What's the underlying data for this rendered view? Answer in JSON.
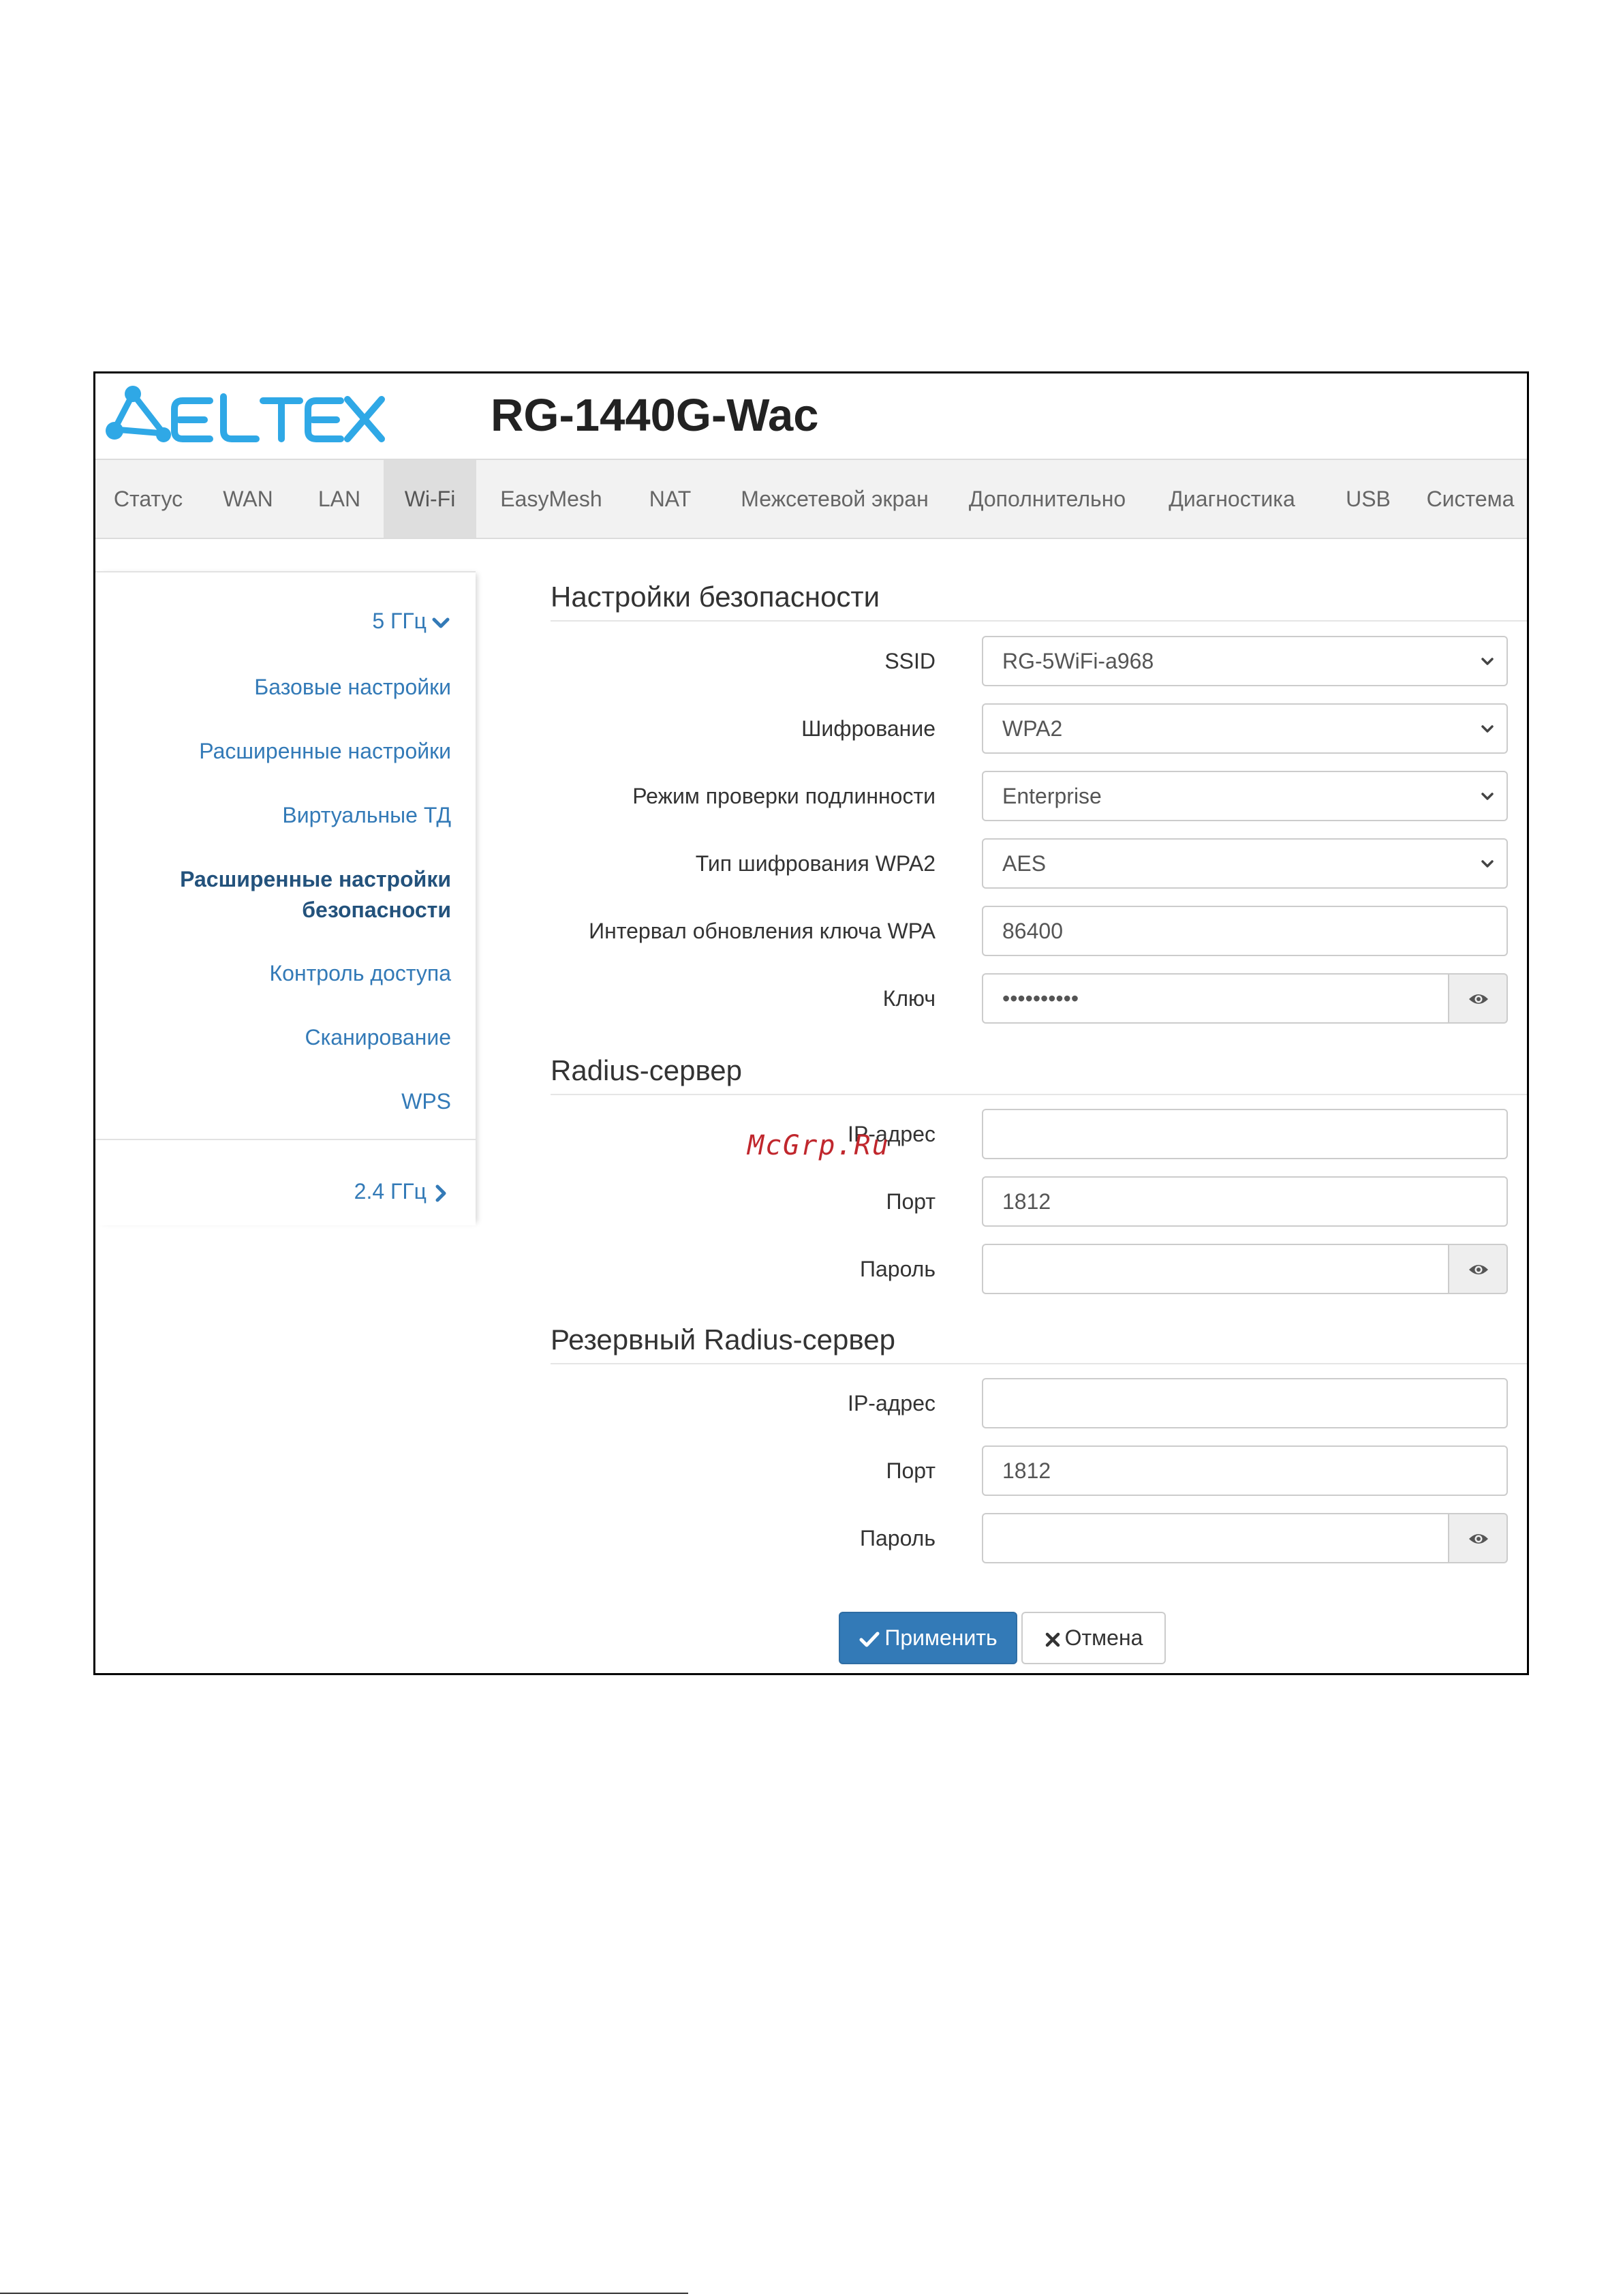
{
  "header": {
    "logo_text": "ELTEX",
    "device_title": "RG-1440G-Wac"
  },
  "colors": {
    "brand_blue": "#2fa8e6",
    "link": "#337ab7",
    "primary_button": "#337ab7",
    "watermark": "#c0272d"
  },
  "nav": {
    "items": [
      {
        "label": "Статус"
      },
      {
        "label": "WAN"
      },
      {
        "label": "LAN"
      },
      {
        "label": "Wi-Fi",
        "active": true
      },
      {
        "label": "EasyMesh"
      },
      {
        "label": "NAT"
      },
      {
        "label": "Межсетевой экран"
      },
      {
        "label": "Дополнительно"
      },
      {
        "label": "Диагностика"
      },
      {
        "label": "USB"
      },
      {
        "label": "Система"
      }
    ]
  },
  "sidebar": {
    "band_5": {
      "label": "5 ГГц",
      "icon": "chevron-down-icon"
    },
    "items": [
      {
        "label": "Базовые настройки"
      },
      {
        "label": "Расширенные настройки"
      },
      {
        "label": "Виртуальные ТД"
      },
      {
        "label_line1": "Расширенные настройки",
        "label_line2": "безопасности",
        "active": true
      },
      {
        "label": "Контроль доступа"
      },
      {
        "label": "Сканирование"
      },
      {
        "label": "WPS"
      }
    ],
    "band_24": {
      "label": "2.4 ГГц",
      "icon": "chevron-right-icon"
    }
  },
  "security": {
    "title": "Настройки безопасности",
    "ssid": {
      "label": "SSID",
      "value": "RG-5WiFi-a968"
    },
    "encryption": {
      "label": "Шифрование",
      "value": "WPA2"
    },
    "auth_mode": {
      "label": "Режим проверки подлинности",
      "value": "Enterprise"
    },
    "wpa2_cipher": {
      "label": "Тип шифрования WPA2",
      "value": "AES"
    },
    "key_interval": {
      "label": "Интервал обновления ключа WPA",
      "value": "86400"
    },
    "key": {
      "label": "Ключ",
      "value": "••••••••••"
    }
  },
  "radius": {
    "title": "Radius-сервер",
    "ip": {
      "label": "IP-адрес",
      "value": ""
    },
    "port": {
      "label": "Порт",
      "value": "1812"
    },
    "password": {
      "label": "Пароль",
      "value": ""
    }
  },
  "radius_backup": {
    "title": "Резервный Radius-сервер",
    "ip": {
      "label": "IP-адрес",
      "value": ""
    },
    "port": {
      "label": "Порт",
      "value": "1812"
    },
    "password": {
      "label": "Пароль",
      "value": ""
    }
  },
  "actions": {
    "apply_label": "Применить",
    "cancel_label": "Отмена"
  },
  "watermark": "McGrp.Ru"
}
